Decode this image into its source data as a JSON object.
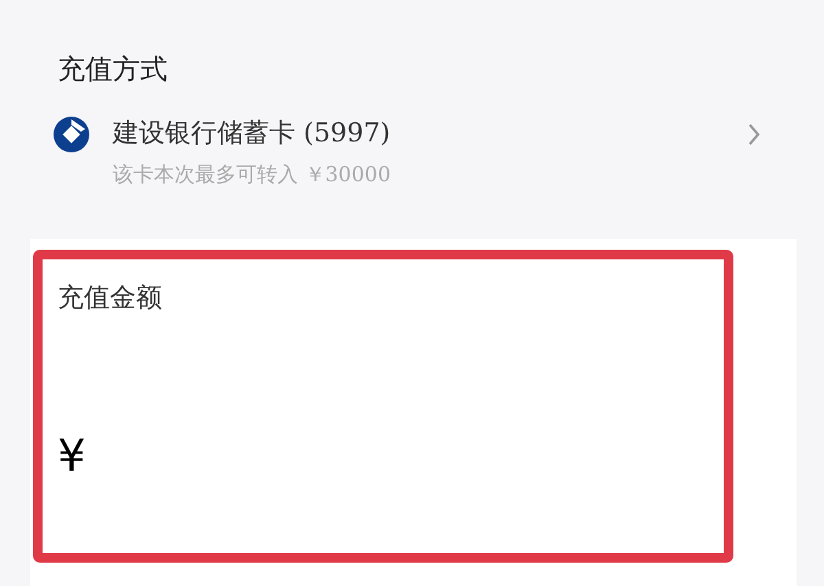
{
  "payment_method": {
    "title": "充值方式",
    "card_name": "建设银行储蓄卡 (5997)",
    "limit_note": "该卡本次最多可转入 ￥30000"
  },
  "amount": {
    "label": "充值金额",
    "currency": "¥",
    "highlighted": true
  }
}
